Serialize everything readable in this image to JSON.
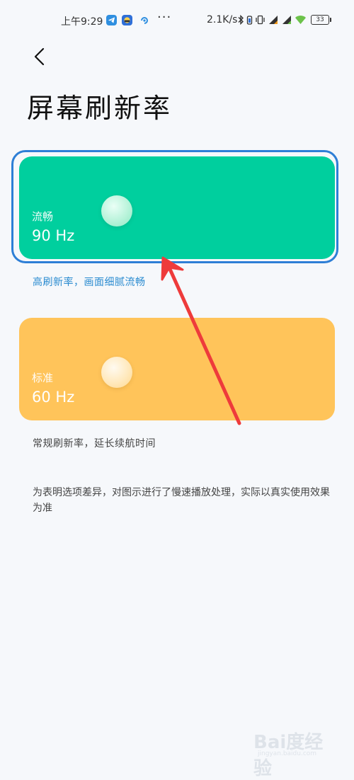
{
  "status_bar": {
    "time": "上午9:29",
    "more": "···",
    "speed": "2.1K/s",
    "battery": "33"
  },
  "title": "屏幕刷新率",
  "options": [
    {
      "label": "流畅",
      "rate": "90 Hz",
      "description": "高刷新率，画面细腻流畅",
      "selected": true,
      "color": "#00cf9e"
    },
    {
      "label": "标准",
      "rate": "60 Hz",
      "description": "常规刷新率，延长续航时间",
      "selected": false,
      "color": "#ffc45a"
    }
  ],
  "footnote": "为表明选项差异，对图示进行了慢速播放处理，实际以真实使用效果为准",
  "accent_color": "#2a8bd0",
  "watermark": {
    "logo": "Bai度经验",
    "url": "jingyan.baidu.com"
  }
}
